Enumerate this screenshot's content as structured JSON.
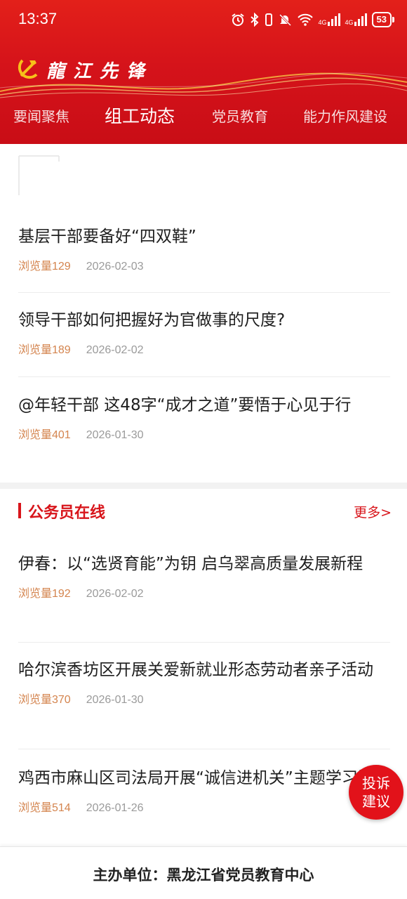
{
  "status_bar": {
    "time": "13:37",
    "network_1": "4G",
    "network_2": "4G",
    "battery": "53"
  },
  "header": {
    "logo_text": "龍江先锋",
    "tabs": [
      {
        "label": "要闻聚焦",
        "active": false
      },
      {
        "label": "组工动态",
        "active": true
      },
      {
        "label": "党员教育",
        "active": false
      },
      {
        "label": "能力作风建设",
        "active": false
      }
    ]
  },
  "articles": [
    {
      "title": "基层干部要备好“四双鞋”",
      "views": "浏览量129",
      "date": "2026-02-03"
    },
    {
      "title": "领导干部如何把握好为官做事的尺度?",
      "views": "浏览量189",
      "date": "2026-02-02"
    },
    {
      "title": "@年轻干部 这48字“成才之道”要悟于心见于行",
      "views": "浏览量401",
      "date": "2026-01-30"
    }
  ],
  "section": {
    "title": "公务员在线",
    "more": "更多>"
  },
  "section_articles": [
    {
      "title": "伊春：以“选贤育能”为钥 启乌翠高质量发展新程",
      "views": "浏览量192",
      "date": "2026-02-02"
    },
    {
      "title": "哈尔滨香坊区开展关爱新就业形态劳动者亲子活动",
      "views": "浏览量370",
      "date": "2026-01-30"
    },
    {
      "title": "鸡西市麻山区司法局开展“诚信进机关”主题学习活动",
      "views": "浏览量514",
      "date": "2026-01-26"
    }
  ],
  "float_button": {
    "line1": "投诉",
    "line2": "建议"
  },
  "footer": {
    "text": "主办单位：黑龙江省党员教育中心"
  },
  "colors": {
    "brand_red": "#d8151b",
    "views_orange": "#d4844e",
    "date_gray": "#9a9a9a"
  }
}
